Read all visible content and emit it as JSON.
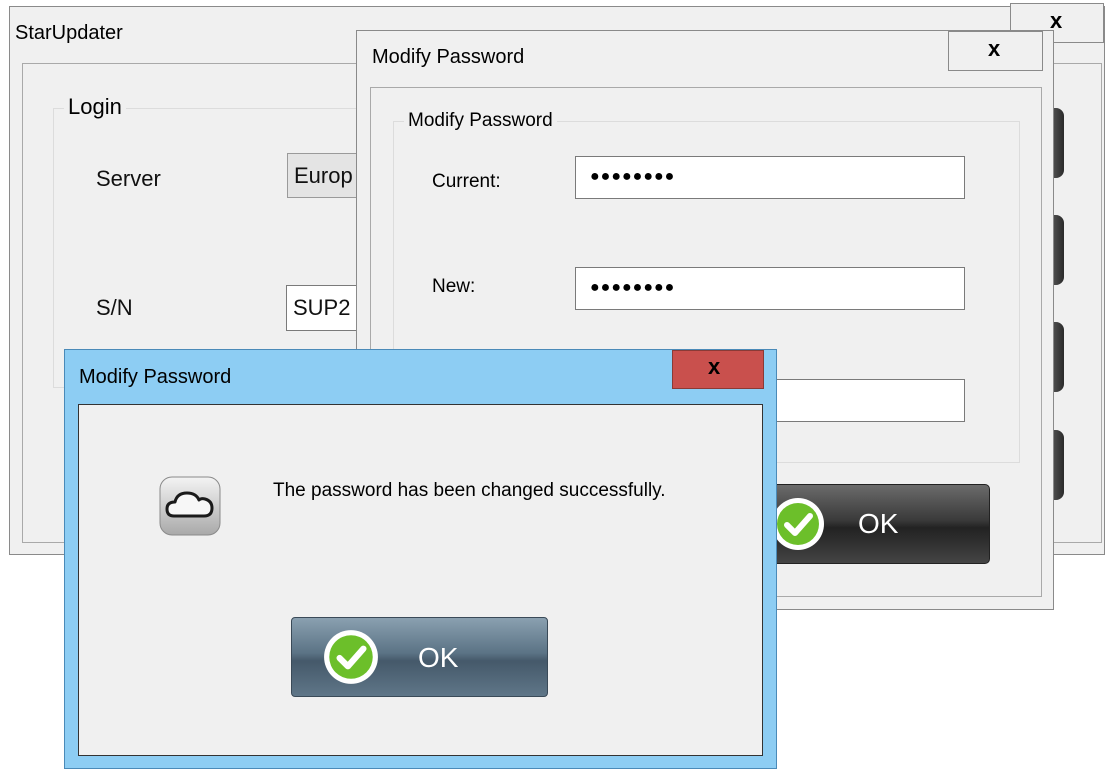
{
  "main_window": {
    "title": "StarUpdater",
    "close_label": "x",
    "login": {
      "legend": "Login",
      "server_label": "Server",
      "server_value": "Europ",
      "sn_label": "S/N",
      "sn_value": "SUP2"
    }
  },
  "modify_password_window": {
    "title": "Modify Password",
    "close_label": "x",
    "group_legend": "Modify Password",
    "current_label": "Current:",
    "current_value": "●●●●●●●●",
    "new_label": "New:",
    "new_value": "●●●●●●●●",
    "ok_label": "OK"
  },
  "success_dialog": {
    "title": "Modify Password",
    "close_label": "x",
    "message": "The password has been changed successfully.",
    "ok_label": "OK",
    "icon": "cloud-icon"
  },
  "colors": {
    "dialog_titlebar": "#8dcdf3",
    "close_button_red": "#c9504d",
    "dark_button": "#3a3a3a",
    "steel_button": "#5b7385",
    "check_green": "#6cbf2a"
  }
}
